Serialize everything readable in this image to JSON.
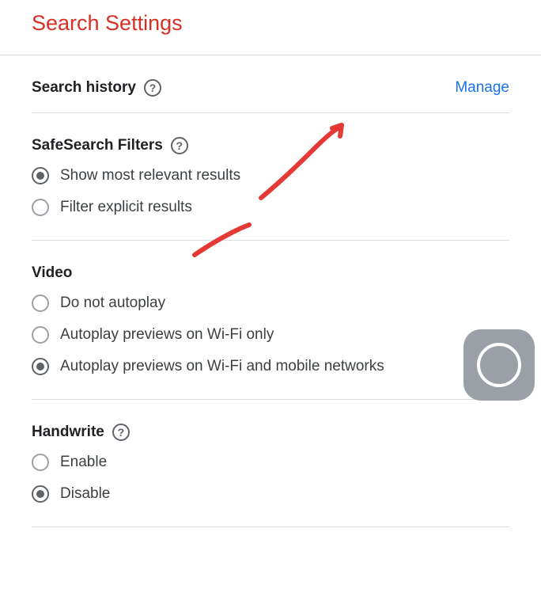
{
  "pageTitle": "Search Settings",
  "searchHistory": {
    "title": "Search history",
    "manageLink": "Manage"
  },
  "safeSearch": {
    "title": "SafeSearch Filters",
    "options": [
      {
        "label": "Show most relevant results",
        "selected": true
      },
      {
        "label": "Filter explicit results",
        "selected": false
      }
    ]
  },
  "video": {
    "title": "Video",
    "options": [
      {
        "label": "Do not autoplay",
        "selected": false
      },
      {
        "label": "Autoplay previews on Wi-Fi only",
        "selected": false
      },
      {
        "label": "Autoplay previews on Wi-Fi and mobile networks",
        "selected": true
      }
    ]
  },
  "handwrite": {
    "title": "Handwrite",
    "options": [
      {
        "label": "Enable",
        "selected": false
      },
      {
        "label": "Disable",
        "selected": true
      }
    ]
  }
}
